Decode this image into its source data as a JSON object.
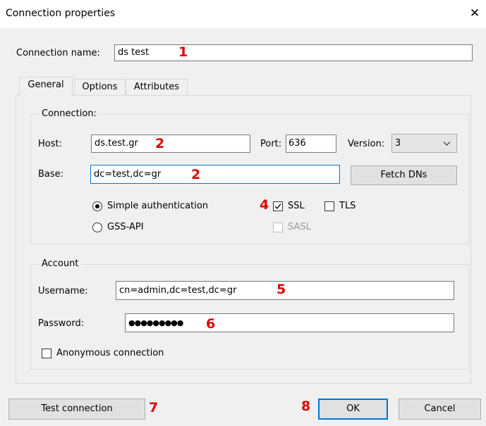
{
  "window": {
    "title": "Connection properties",
    "close_glyph": "✕"
  },
  "connection_name": {
    "label": "Connection name:",
    "value": "ds test"
  },
  "tabs": [
    {
      "label": "General",
      "active": true
    },
    {
      "label": "Options",
      "active": false
    },
    {
      "label": "Attributes",
      "active": false
    }
  ],
  "connection_group": {
    "legend": "Connection:",
    "host_label": "Host:",
    "host_value": "ds.test.gr",
    "port_label": "Port:",
    "port_value": "636",
    "version_label": "Version:",
    "version_value": "3",
    "base_label": "Base:",
    "base_value": "dc=test,dc=gr",
    "fetch_dns_label": "Fetch DNs",
    "auth_simple_label": "Simple authentication",
    "auth_simple_selected": true,
    "auth_gss_label": "GSS-API",
    "auth_gss_selected": false,
    "ssl_label": "SSL",
    "ssl_checked": true,
    "tls_label": "TLS",
    "tls_checked": false,
    "sasl_label": "SASL",
    "sasl_checked": false,
    "sasl_disabled": true
  },
  "account_group": {
    "legend": "Account",
    "username_label": "Username:",
    "username_value": "cn=admin,dc=test,dc=gr",
    "password_label": "Password:",
    "password_value": "●●●●●●●●●",
    "anonymous_label": "Anonymous connection",
    "anonymous_checked": false
  },
  "buttons": {
    "test_connection": "Test connection",
    "ok": "OK",
    "cancel": "Cancel"
  },
  "annotations": {
    "n1": "1",
    "n2a": "2",
    "n2b": "2",
    "n4": "4",
    "n5": "5",
    "n6": "6",
    "n7": "7",
    "n8": "8",
    "color": "#e00000"
  },
  "colors": {
    "focus_border": "#0078d7",
    "dialog_bg": "#f0f0f0"
  }
}
